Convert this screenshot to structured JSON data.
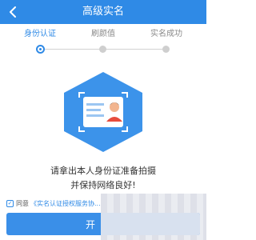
{
  "header": {
    "title": "高级实名",
    "back_icon": "chevron-left-icon"
  },
  "steps": [
    {
      "label": "身份认证",
      "active": true
    },
    {
      "label": "刷颜值",
      "active": false
    },
    {
      "label": "实名成功",
      "active": false
    }
  ],
  "illustration": {
    "icon": "id-card-icon"
  },
  "prompt": {
    "line1": "请拿出本人身份证准备拍摄",
    "line2": "并保持网络良好!"
  },
  "agreement": {
    "checked": true,
    "prefix": "同意",
    "link": "《实名认证授权服务协..."
  },
  "actions": {
    "start_label": "开"
  },
  "colors": {
    "primary": "#2f8ae6",
    "hexagon": "#3c93ea"
  }
}
